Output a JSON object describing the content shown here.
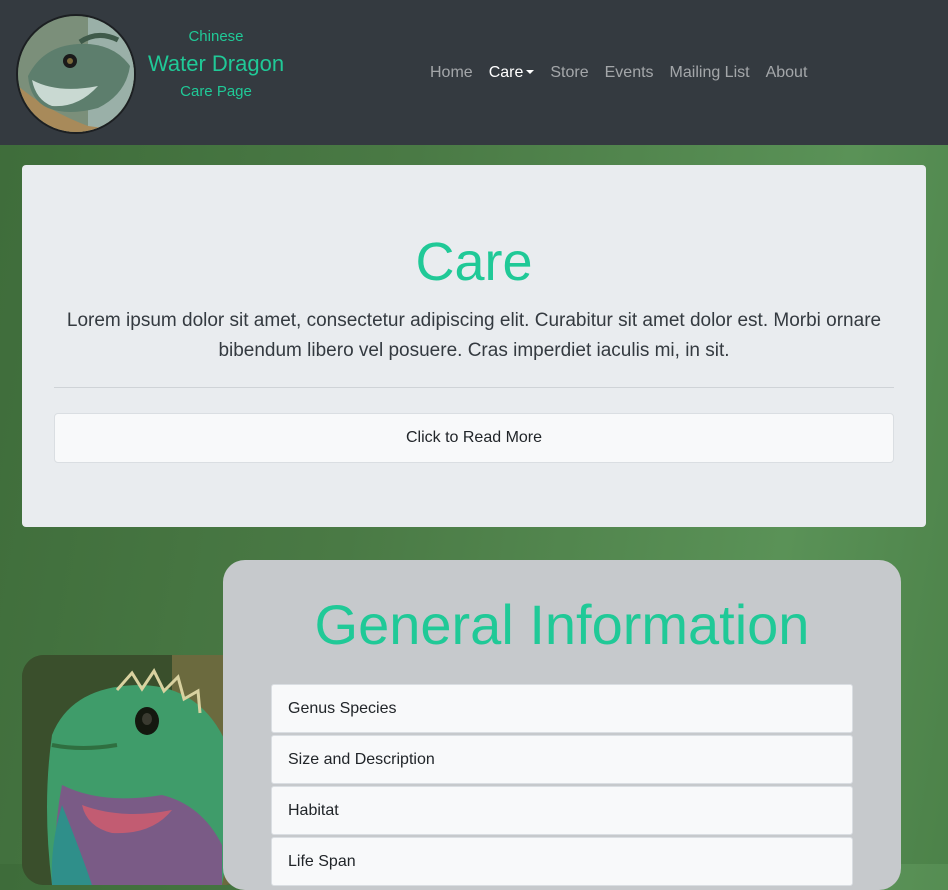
{
  "brand": {
    "line1": "Chinese",
    "line2": "Water Dragon",
    "line3": "Care Page"
  },
  "nav": [
    {
      "label": "Home"
    },
    {
      "label": "Care"
    },
    {
      "label": "Store"
    },
    {
      "label": "Events"
    },
    {
      "label": "Mailing List"
    },
    {
      "label": "About"
    }
  ],
  "nav_active": "Care",
  "jumbotron": {
    "title": "Care",
    "text": "Lorem ipsum dolor sit amet, consectetur adipiscing elit. Curabitur sit amet dolor est. Morbi ornare bibendum libero vel posuere. Cras imperdiet iaculis mi, in sit.",
    "button": "Click to Read More"
  },
  "general_info": {
    "title": "General Information",
    "items": [
      {
        "label": "Genus Species"
      },
      {
        "label": "Size and Description"
      },
      {
        "label": "Habitat"
      },
      {
        "label": "Life Span"
      }
    ]
  },
  "colors": {
    "accent": "#20c997",
    "navbar": "#343a40",
    "jumbotron": "#e9ecef",
    "card": "#c6c9cc"
  },
  "icons": {
    "dropdown": "caret-down-icon"
  }
}
